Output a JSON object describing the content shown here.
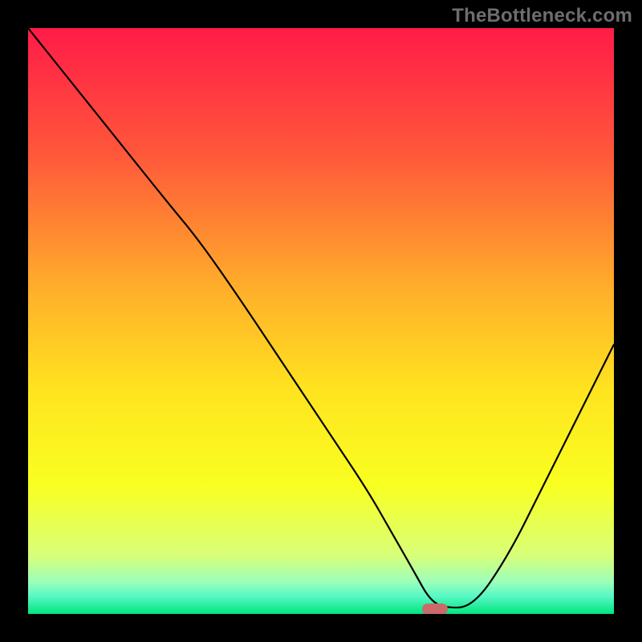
{
  "watermark": "TheBottleneck.com",
  "chart_data": {
    "type": "line",
    "title": "",
    "xlabel": "",
    "ylabel": "",
    "xlim": [
      0,
      100
    ],
    "ylim": [
      0,
      100
    ],
    "grid": false,
    "legend": false,
    "background_gradient_stops": [
      {
        "offset": 0.0,
        "color": "#ff1b48"
      },
      {
        "offset": 0.22,
        "color": "#ff593a"
      },
      {
        "offset": 0.45,
        "color": "#ffb02a"
      },
      {
        "offset": 0.62,
        "color": "#ffe41f"
      },
      {
        "offset": 0.78,
        "color": "#f9ff21"
      },
      {
        "offset": 0.9,
        "color": "#d8ff78"
      },
      {
        "offset": 0.945,
        "color": "#9cffba"
      },
      {
        "offset": 0.97,
        "color": "#57f7c4"
      },
      {
        "offset": 1.0,
        "color": "#00e57d"
      }
    ],
    "series": [
      {
        "name": "bottleneck-curve",
        "color": "#000000",
        "x": [
          0,
          8,
          16,
          24,
          29,
          36,
          44,
          52,
          58,
          62,
          66,
          68.5,
          71,
          76,
          82,
          88,
          94,
          100
        ],
        "y": [
          100,
          90,
          80,
          70,
          64,
          54,
          42,
          30,
          21,
          14,
          7,
          2.5,
          1,
          1.2,
          10,
          22,
          34,
          46
        ]
      }
    ],
    "marker": {
      "name": "optimal-point",
      "x": 69.5,
      "y": 0.8,
      "color": "#cb6a6b"
    }
  }
}
